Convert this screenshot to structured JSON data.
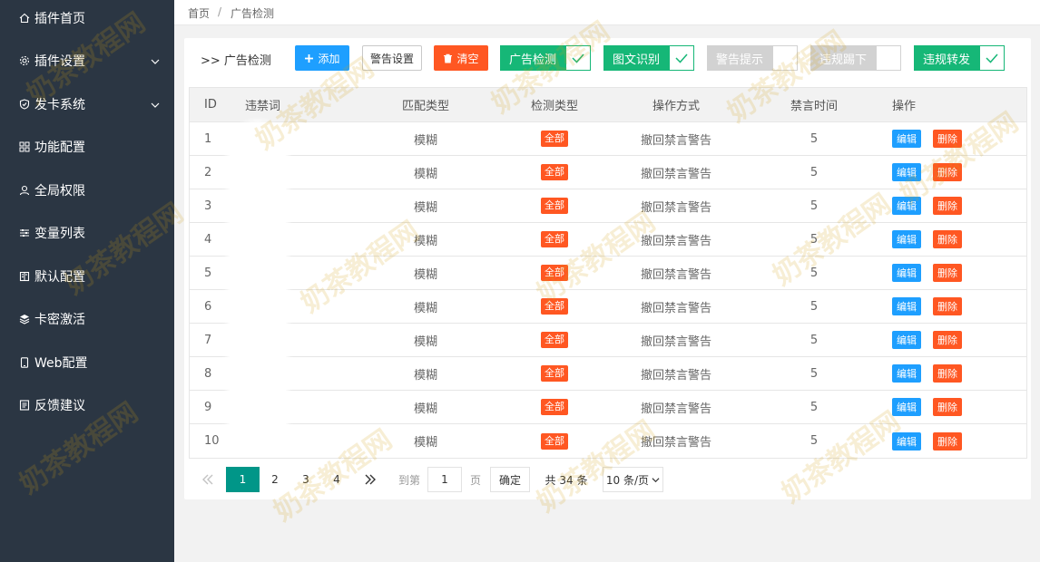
{
  "sidebar": {
    "items": [
      {
        "label": "插件首页"
      },
      {
        "label": "插件设置"
      },
      {
        "label": "发卡系统"
      },
      {
        "label": "功能配置"
      },
      {
        "label": "全局权限"
      },
      {
        "label": "变量列表"
      },
      {
        "label": "默认配置"
      },
      {
        "label": "卡密激活"
      },
      {
        "label": "Web配置"
      },
      {
        "label": "反馈建议"
      }
    ]
  },
  "breadcrumb": {
    "home": "首页",
    "separator": "/",
    "current": "广告检测"
  },
  "toolbar": {
    "title": ">> 广告检测",
    "add_label": "添加",
    "warn_settings_label": "警告设置",
    "clear_label": "清空",
    "switches": [
      {
        "label": "广告检测",
        "on": true
      },
      {
        "label": "图文识别",
        "on": true
      },
      {
        "label": "警告提示",
        "on": false
      },
      {
        "label": "违规踢下",
        "on": false
      },
      {
        "label": "违规转发",
        "on": true
      }
    ]
  },
  "table": {
    "headers": [
      "ID",
      "违禁词",
      "匹配类型",
      "检测类型",
      "操作方式",
      "禁言时间",
      "操作"
    ],
    "rows": [
      {
        "id": "1",
        "word": "",
        "match": "模糊",
        "detect": "全部",
        "action": "撤回禁言警告",
        "mute": "5"
      },
      {
        "id": "2",
        "word": "",
        "match": "模糊",
        "detect": "全部",
        "action": "撤回禁言警告",
        "mute": "5"
      },
      {
        "id": "3",
        "word": "",
        "match": "模糊",
        "detect": "全部",
        "action": "撤回禁言警告",
        "mute": "5"
      },
      {
        "id": "4",
        "word": "",
        "match": "模糊",
        "detect": "全部",
        "action": "撤回禁言警告",
        "mute": "5"
      },
      {
        "id": "5",
        "word": "",
        "match": "模糊",
        "detect": "全部",
        "action": "撤回禁言警告",
        "mute": "5"
      },
      {
        "id": "6",
        "word": "",
        "match": "模糊",
        "detect": "全部",
        "action": "撤回禁言警告",
        "mute": "5"
      },
      {
        "id": "7",
        "word": "",
        "match": "模糊",
        "detect": "全部",
        "action": "撤回禁言警告",
        "mute": "5"
      },
      {
        "id": "8",
        "word": "",
        "match": "模糊",
        "detect": "全部",
        "action": "撤回禁言警告",
        "mute": "5"
      },
      {
        "id": "9",
        "word": "",
        "match": "模糊",
        "detect": "全部",
        "action": "撤回禁言警告",
        "mute": "5"
      },
      {
        "id": "10",
        "word": "",
        "match": "模糊",
        "detect": "全部",
        "action": "撤回禁言警告",
        "mute": "5"
      }
    ],
    "edit_label": "编辑",
    "delete_label": "删除"
  },
  "pagination": {
    "pages": [
      "1",
      "2",
      "3",
      "4"
    ],
    "current_page": "1",
    "goto_label": "到第",
    "goto_value": "1",
    "page_unit": "页",
    "confirm_label": "确定",
    "total_label": "共 34 条",
    "page_size": "10 条/页"
  },
  "watermark": "奶茶教程网",
  "colors": {
    "sidebar": "#2b3643",
    "primary": "#1e9fff",
    "danger": "#ff5722",
    "success": "#16b777",
    "page_active": "#009688"
  }
}
